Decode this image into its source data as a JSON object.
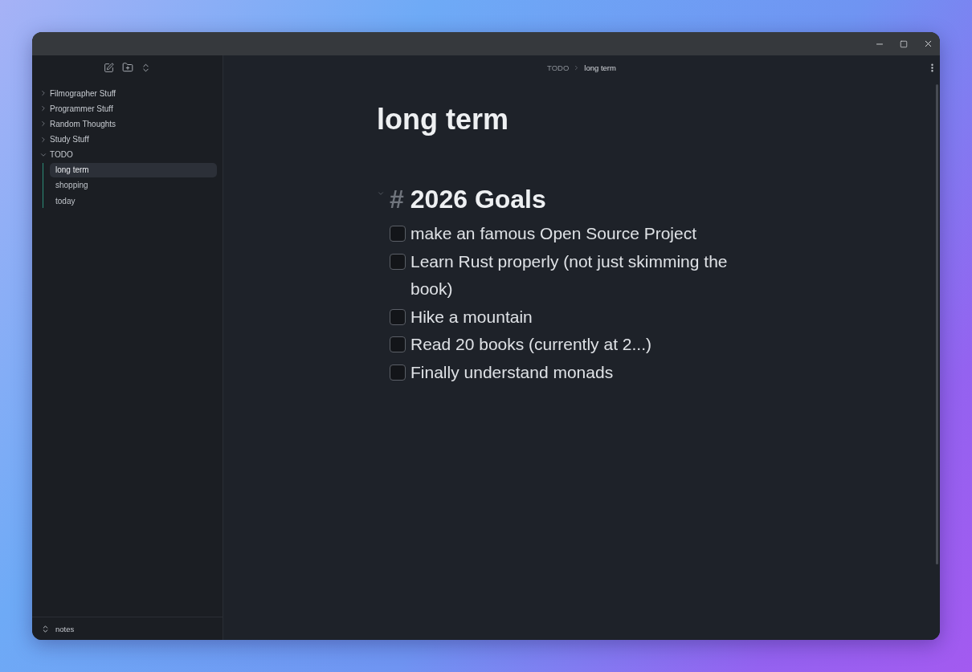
{
  "sidebar": {
    "items": [
      {
        "label": "Filmographer Stuff",
        "expanded": false,
        "selected": false
      },
      {
        "label": "Programmer Stuff",
        "expanded": false,
        "selected": false
      },
      {
        "label": "Random Thoughts",
        "expanded": false,
        "selected": false
      },
      {
        "label": "Study Stuff",
        "expanded": false,
        "selected": false
      },
      {
        "label": "TODO",
        "expanded": true,
        "selected": false,
        "children": [
          {
            "label": "long term",
            "selected": true
          },
          {
            "label": "shopping",
            "selected": false
          },
          {
            "label": "today",
            "selected": false
          }
        ]
      }
    ],
    "vault": "notes"
  },
  "breadcrumb": [
    "TODO",
    "long term"
  ],
  "note": {
    "title": "long term",
    "heading": {
      "marker": "#",
      "text": "2026 Goals",
      "expanded": true
    },
    "tasks": [
      {
        "text": "make an famous Open Source Project",
        "checked": false
      },
      {
        "text": "Learn Rust properly (not just skimming the book)",
        "checked": false
      },
      {
        "text": "Hike a mountain",
        "checked": false
      },
      {
        "text": "Read 20 books (currently at 2...)",
        "checked": false
      },
      {
        "text": "Finally understand monads",
        "checked": false
      }
    ]
  }
}
